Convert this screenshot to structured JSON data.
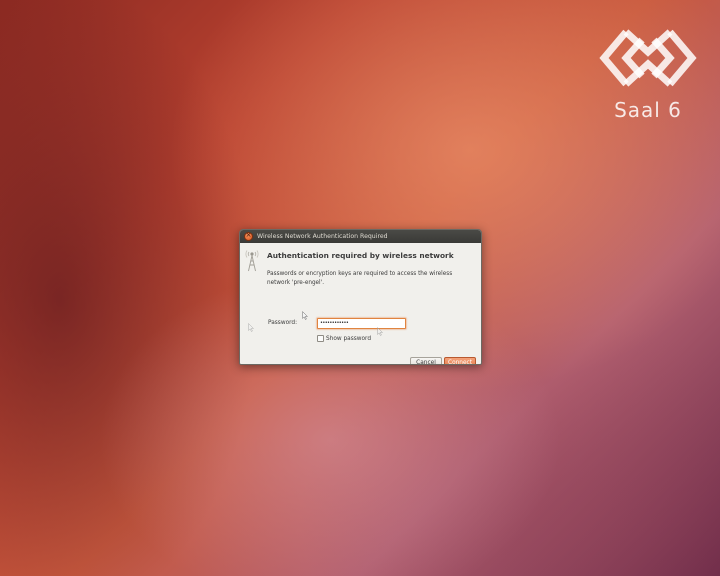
{
  "watermark": {
    "text": "Saal 6"
  },
  "dialog": {
    "title": "Wireless Network Authentication Required",
    "heading": "Authentication required by wireless network",
    "description": "Passwords or encryption keys are required to access the wireless network 'pre-engel'.",
    "password_label": "Password:",
    "password_value": "••••••••••••",
    "show_password_label": "Show password",
    "show_password_checked": false,
    "cancel_label": "Cancel",
    "connect_label": "Connect"
  },
  "icons": {
    "close": "close-icon",
    "wifi": "wireless-network-icon",
    "pointer": "mouse-pointer-icon"
  },
  "colors": {
    "accent": "#e27545",
    "titlebar": "#3a3a37",
    "dialog_bg": "#f1f0ec"
  }
}
